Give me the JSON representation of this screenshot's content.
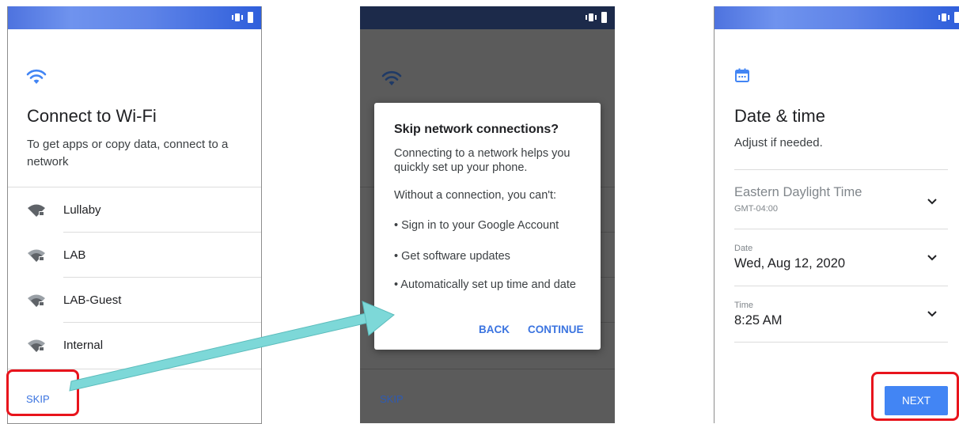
{
  "colors": {
    "accent": "#3b74e0",
    "next_button": "#4285f4",
    "highlight": "#e8141c",
    "arrow": "#7dd8d8"
  },
  "wifi_screen": {
    "title": "Connect to Wi-Fi",
    "subtitle": "To get apps or copy data, connect to a network",
    "networks": [
      {
        "name": "Lullaby",
        "icon": "wifi-lock-icon"
      },
      {
        "name": "LAB",
        "icon": "wifi-lock-icon"
      },
      {
        "name": "LAB-Guest",
        "icon": "wifi-lock-icon"
      },
      {
        "name": "Internal",
        "icon": "wifi-lock-icon"
      }
    ],
    "skip_label": "SKIP"
  },
  "skip_dialog": {
    "title": "Skip network connections?",
    "body_1": "Connecting to a network helps you quickly set up your phone.",
    "body_2": "Without a connection, you can't:",
    "bullets": [
      "• Sign in to your Google Account",
      "• Get software updates",
      "• Automatically set up time and date"
    ],
    "back_label": "BACK",
    "continue_label": "CONTINUE",
    "background_skip_label": "SKIP"
  },
  "date_screen": {
    "title": "Date & time",
    "subtitle": "Adjust if needed.",
    "timezone": {
      "name": "Eastern Daylight Time",
      "offset": "GMT-04:00"
    },
    "date": {
      "label": "Date",
      "value": "Wed, Aug 12, 2020"
    },
    "time": {
      "label": "Time",
      "value": "8:25 AM"
    },
    "next_label": "NEXT"
  }
}
